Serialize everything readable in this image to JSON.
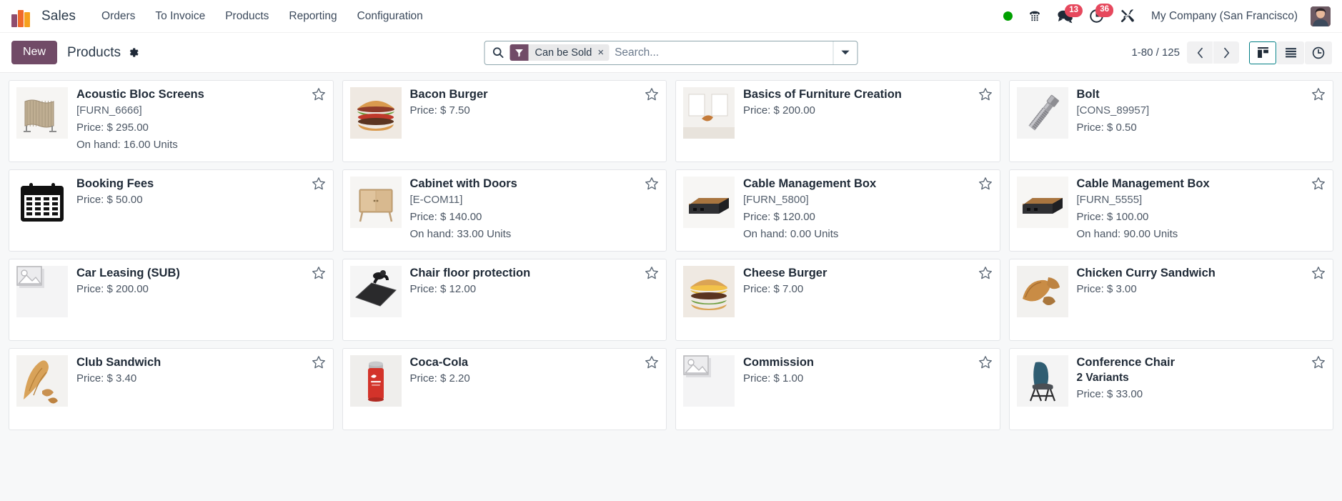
{
  "navbar": {
    "app_name": "Sales",
    "menu": [
      {
        "label": "Orders"
      },
      {
        "label": "To Invoice"
      },
      {
        "label": "Products"
      },
      {
        "label": "Reporting"
      },
      {
        "label": "Configuration"
      }
    ],
    "systray": {
      "status_color": "#00a000",
      "messages_badge": "13",
      "activities_badge": "36",
      "company": "My Company (San Francisco)"
    }
  },
  "control_panel": {
    "new_label": "New",
    "breadcrumb": "Products",
    "search": {
      "placeholder": "Search...",
      "facet_label": "Can be Sold",
      "facet_remove": "×"
    },
    "pager": "1-80 / 125",
    "accent_purple": "#714B67",
    "accent_teal": "#017E84"
  },
  "products": [
    {
      "name": "Acoustic Bloc Screens",
      "ref": "[FURN_6666]",
      "price": "Price: $ 295.00",
      "onhand": "On hand: 16.00 Units",
      "variants": "",
      "img": "screen"
    },
    {
      "name": "Bacon Burger",
      "ref": "",
      "price": "Price: $ 7.50",
      "onhand": "",
      "variants": "",
      "img": "burger-bacon"
    },
    {
      "name": "Basics of Furniture Creation",
      "ref": "",
      "price": "Price: $ 200.00",
      "onhand": "",
      "variants": "",
      "img": "room"
    },
    {
      "name": "Bolt",
      "ref": "[CONS_89957]",
      "price": "Price: $ 0.50",
      "onhand": "",
      "variants": "",
      "img": "bolt"
    },
    {
      "name": "Booking Fees",
      "ref": "",
      "price": "Price: $ 50.00",
      "onhand": "",
      "variants": "",
      "img": "calendar"
    },
    {
      "name": "Cabinet with Doors",
      "ref": "[E-COM11]",
      "price": "Price: $ 140.00",
      "onhand": "On hand: 33.00 Units",
      "variants": "",
      "img": "cabinet"
    },
    {
      "name": "Cable Management Box",
      "ref": "[FURN_5800]",
      "price": "Price: $ 120.00",
      "onhand": "On hand: 0.00 Units",
      "variants": "",
      "img": "cablebox"
    },
    {
      "name": "Cable Management Box",
      "ref": "[FURN_5555]",
      "price": "Price: $ 100.00",
      "onhand": "On hand: 90.00 Units",
      "variants": "",
      "img": "cablebox"
    },
    {
      "name": "Car Leasing (SUB)",
      "ref": "",
      "price": "Price: $ 200.00",
      "onhand": "",
      "variants": "",
      "img": "placeholder"
    },
    {
      "name": "Chair floor protection",
      "ref": "",
      "price": "Price: $ 12.00",
      "onhand": "",
      "variants": "",
      "img": "floormat"
    },
    {
      "name": "Cheese Burger",
      "ref": "",
      "price": "Price: $ 7.00",
      "onhand": "",
      "variants": "",
      "img": "burger-cheese"
    },
    {
      "name": "Chicken Curry Sandwich",
      "ref": "",
      "price": "Price: $ 3.00",
      "onhand": "",
      "variants": "",
      "img": "sandwich"
    },
    {
      "name": "Club Sandwich",
      "ref": "",
      "price": "Price: $ 3.40",
      "onhand": "",
      "variants": "",
      "img": "baguette"
    },
    {
      "name": "Coca-Cola",
      "ref": "",
      "price": "Price: $ 2.20",
      "onhand": "",
      "variants": "",
      "img": "cola"
    },
    {
      "name": "Commission",
      "ref": "",
      "price": "Price: $ 1.00",
      "onhand": "",
      "variants": "",
      "img": "placeholder"
    },
    {
      "name": "Conference Chair",
      "ref": "",
      "price": "Price: $ 33.00",
      "onhand": "",
      "variants": "2 Variants",
      "img": "chair"
    }
  ]
}
